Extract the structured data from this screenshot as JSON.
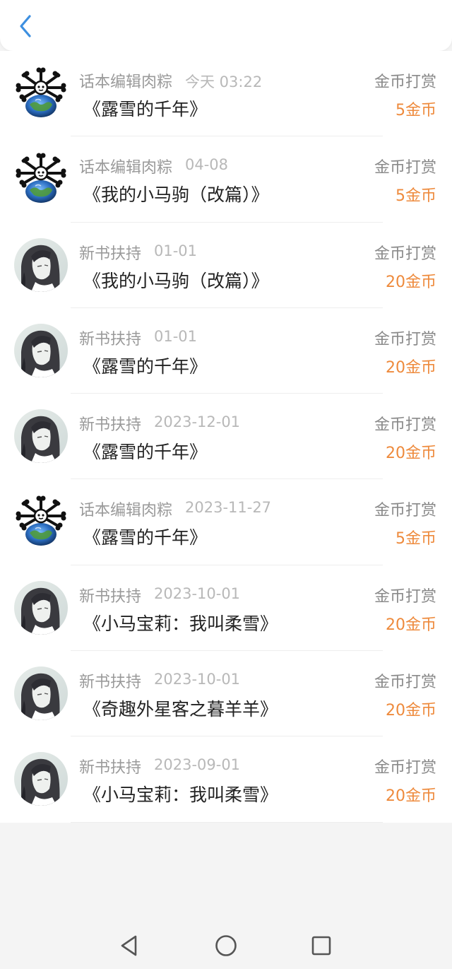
{
  "header": {
    "back_icon": "chevron-left-icon"
  },
  "rows": [
    {
      "avatar": "bone-earth-avatar",
      "sender": "话本编辑肉粽",
      "date": "今天 03:22",
      "book": "《露雪的千年》",
      "type": "金币打赏",
      "amount": "5金币"
    },
    {
      "avatar": "bone-earth-avatar",
      "sender": "话本编辑肉粽",
      "date": "04-08",
      "book": "《我的小马驹（改篇）》",
      "type": "金币打赏",
      "amount": "5金币"
    },
    {
      "avatar": "portrait-avatar",
      "sender": "新书扶持",
      "date": "01-01",
      "book": "《我的小马驹（改篇）》",
      "type": "金币打赏",
      "amount": "20金币"
    },
    {
      "avatar": "portrait-avatar",
      "sender": "新书扶持",
      "date": "01-01",
      "book": "《露雪的千年》",
      "type": "金币打赏",
      "amount": "20金币"
    },
    {
      "avatar": "portrait-avatar",
      "sender": "新书扶持",
      "date": "2023-12-01",
      "book": "《露雪的千年》",
      "type": "金币打赏",
      "amount": "20金币"
    },
    {
      "avatar": "bone-earth-avatar",
      "sender": "话本编辑肉粽",
      "date": "2023-11-27",
      "book": "《露雪的千年》",
      "type": "金币打赏",
      "amount": "5金币"
    },
    {
      "avatar": "portrait-avatar",
      "sender": "新书扶持",
      "date": "2023-10-01",
      "book": "《小马宝莉：我叫柔雪》",
      "type": "金币打赏",
      "amount": "20金币"
    },
    {
      "avatar": "portrait-avatar",
      "sender": "新书扶持",
      "date": "2023-10-01",
      "book": "《奇趣外星客之暮羊羊》",
      "type": "金币打赏",
      "amount": "20金币"
    },
    {
      "avatar": "portrait-avatar",
      "sender": "新书扶持",
      "date": "2023-09-01",
      "book": "《小马宝莉：我叫柔雪》",
      "type": "金币打赏",
      "amount": "20金币"
    }
  ],
  "colors": {
    "accent": "#ee8a3c",
    "back": "#3d8fe0"
  },
  "nav": {
    "icons": [
      "back-triangle-icon",
      "home-circle-icon",
      "recents-square-icon"
    ]
  }
}
